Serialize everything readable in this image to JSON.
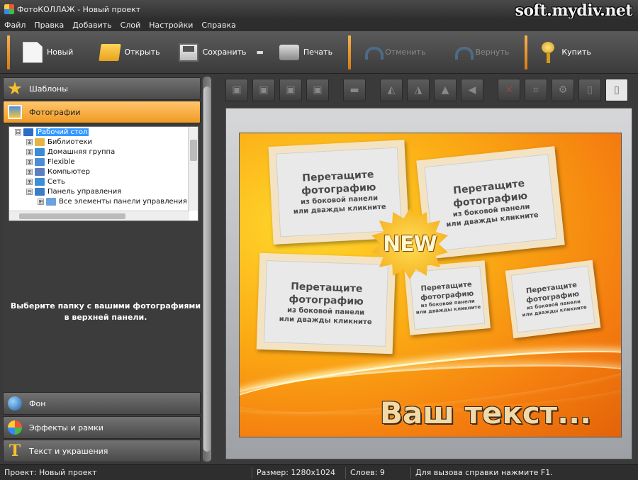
{
  "window": {
    "title": "ФотоКОЛЛАЖ - Новый проект",
    "watermark": "soft.mydiv.net"
  },
  "menu": [
    "Файл",
    "Правка",
    "Добавить",
    "Слой",
    "Настройки",
    "Справка"
  ],
  "toolbar": {
    "new": "Новый",
    "open": "Открыть",
    "save": "Сохранить",
    "print": "Печать",
    "undo": "Отменить",
    "redo": "Вернуть",
    "buy": "Купить"
  },
  "left_panel": {
    "tabs": {
      "templates": "Шаблоны",
      "photos": "Фотографии",
      "background": "Фон",
      "effects": "Эффекты и рамки",
      "text": "Текст и украшения"
    },
    "tree": [
      {
        "label": "Рабочий стол",
        "indent": 0,
        "expander": "⊟",
        "selected": true
      },
      {
        "label": "Библиотеки",
        "indent": 1,
        "expander": "⊞",
        "selected": false
      },
      {
        "label": "Домашняя группа",
        "indent": 1,
        "expander": "⊞",
        "selected": false
      },
      {
        "label": "Flexible",
        "indent": 1,
        "expander": "⊞",
        "selected": false
      },
      {
        "label": "Компьютер",
        "indent": 1,
        "expander": "⊞",
        "selected": false
      },
      {
        "label": "Сеть",
        "indent": 1,
        "expander": "⊞",
        "selected": false
      },
      {
        "label": "Панель управления",
        "indent": 1,
        "expander": "⊟",
        "selected": false
      },
      {
        "label": "Все элементы панели управления",
        "indent": 2,
        "expander": "⊞",
        "selected": false
      }
    ],
    "hint_line1": "Выберите папку с вашими фотографиями",
    "hint_line2": "в верхней панели."
  },
  "canvas": {
    "placeholder_title_1": "Перетащите",
    "placeholder_title_2": "фотографию",
    "placeholder_sub_1": "из боковой панели",
    "placeholder_sub_2": "или дважды кликните",
    "badge": "NEW",
    "overlay_text": "Ваш текст..."
  },
  "status": {
    "project": "Проект: Новый проект",
    "size": "Размер: 1280x1024",
    "layers": "Слоев: 9",
    "help": "Для вызова справки нажмите F1."
  }
}
